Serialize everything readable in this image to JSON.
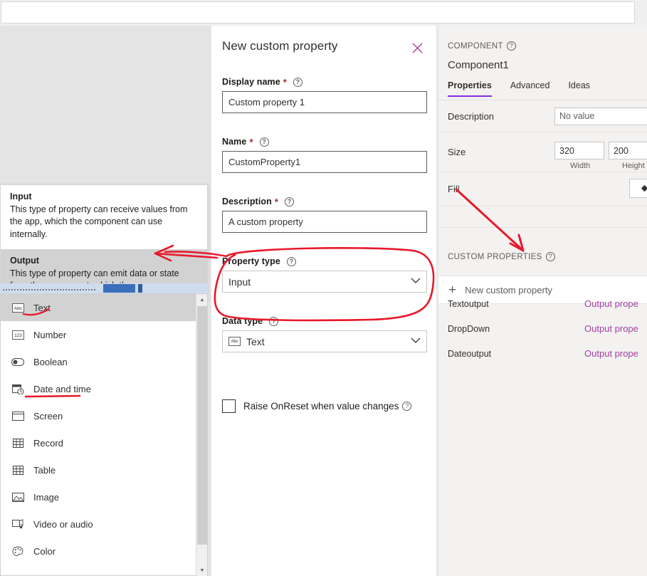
{
  "dialog": {
    "title": "New custom property",
    "close_icon": "close-icon",
    "fields": {
      "display_name": {
        "label": "Display name",
        "required": "*",
        "value": "Custom property 1"
      },
      "name": {
        "label": "Name",
        "required": "*",
        "value": "CustomProperty1"
      },
      "description": {
        "label": "Description",
        "required": "*",
        "value": "A custom property"
      },
      "property_type": {
        "label": "Property type",
        "value": "Input"
      },
      "data_type": {
        "label": "Data type",
        "value": "Text",
        "icon": "abc-icon"
      }
    },
    "checkbox": {
      "label": "Raise OnReset when value changes",
      "checked": false
    },
    "help_glyph": "?"
  },
  "property_type_flyout": {
    "options": [
      {
        "title": "Input",
        "desc": "This type of property can receive values from the app, which the component can use internally.",
        "selected": false
      },
      {
        "title": "Output",
        "desc": "This type of property can emit data or state from the component, which the app can use.",
        "selected": true
      }
    ]
  },
  "data_type_list": {
    "items": [
      {
        "label": "Text",
        "icon": "abc-icon",
        "selected": true
      },
      {
        "label": "Number",
        "icon": "123-icon",
        "selected": false
      },
      {
        "label": "Boolean",
        "icon": "toggle-icon",
        "selected": false
      },
      {
        "label": "Date and time",
        "icon": "calendar-clock-icon",
        "selected": false
      },
      {
        "label": "Screen",
        "icon": "screen-icon",
        "selected": false
      },
      {
        "label": "Record",
        "icon": "grid-icon",
        "selected": false
      },
      {
        "label": "Table",
        "icon": "grid-icon",
        "selected": false
      },
      {
        "label": "Image",
        "icon": "image-icon",
        "selected": false
      },
      {
        "label": "Video or audio",
        "icon": "media-icon",
        "selected": false
      },
      {
        "label": "Color",
        "icon": "palette-icon",
        "selected": false
      }
    ]
  },
  "properties_panel": {
    "eyebrow": "COMPONENT",
    "component_name": "Component1",
    "tabs": [
      {
        "label": "Properties",
        "active": true
      },
      {
        "label": "Advanced",
        "active": false
      },
      {
        "label": "Ideas",
        "active": false
      }
    ],
    "rows": {
      "description": {
        "label": "Description",
        "value": "No value"
      },
      "size": {
        "label": "Size",
        "width": "320",
        "height": "200",
        "width_sub": "Width",
        "height_sub": "Height"
      },
      "fill": {
        "label": "Fill"
      }
    },
    "custom_properties": {
      "heading": "CUSTOM PROPERTIES",
      "new_button": "New custom property",
      "items": [
        {
          "name": "Textoutput",
          "kind": "Output prope"
        },
        {
          "name": "DropDown",
          "kind": "Output prope"
        },
        {
          "name": "Dateoutput",
          "kind": "Output prope"
        }
      ]
    }
  },
  "colors": {
    "annotation_red": "#e8182a",
    "accent_purple": "#a33fa3",
    "tab_underline": "#8a2be2",
    "required_red": "#a4262c",
    "panel_bg": "#f3f2f1"
  }
}
